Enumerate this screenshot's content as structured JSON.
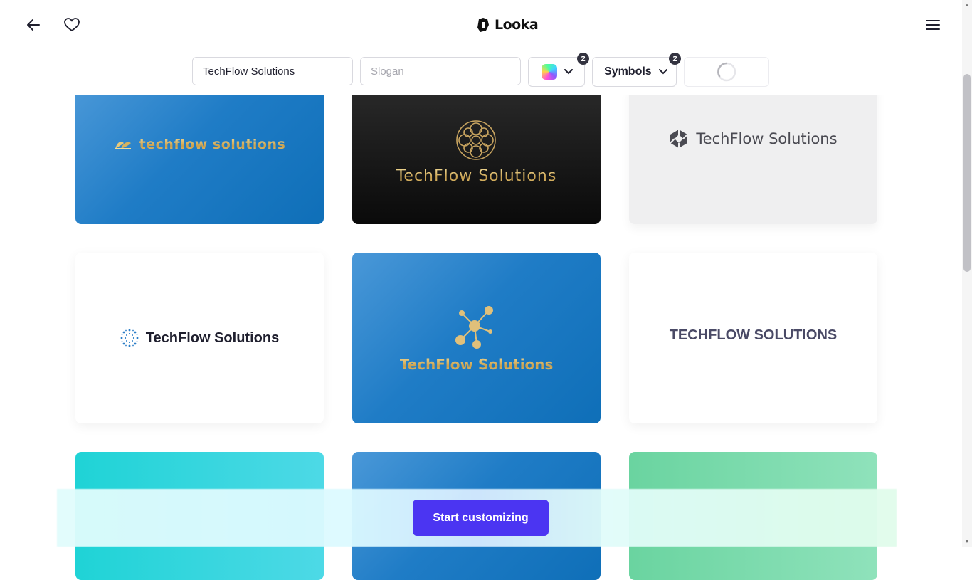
{
  "header": {
    "brand": "Looka",
    "icons": [
      "back-arrow-icon",
      "heart-icon",
      "hamburger-menu-icon"
    ]
  },
  "filters": {
    "company_name_value": "TechFlow Solutions",
    "slogan_placeholder": "Slogan",
    "colors_badge": "2",
    "symbols_label": "Symbols",
    "symbols_badge": "2"
  },
  "logos": [
    {
      "text": "techflow solutions",
      "background": "blue"
    },
    {
      "text": "TechFlow Solutions",
      "background": "black"
    },
    {
      "text": "TechFlow Solutions",
      "background": "grey"
    },
    {
      "text": "TechFlow Solutions",
      "background": "white"
    },
    {
      "text": "TechFlow Solutions",
      "background": "blue"
    },
    {
      "text": "TECHFLOW SOLUTIONS",
      "background": "white"
    }
  ],
  "colors": {
    "accent": "#4b35f2",
    "gold": "#c8a04f",
    "blue_card": "#1f7cc6"
  },
  "cta": {
    "label": "Start customizing"
  }
}
